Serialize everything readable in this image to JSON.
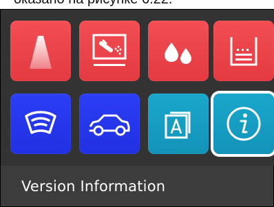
{
  "caption": {
    "text": "оказано на рисунке 6.22."
  },
  "tiles": [
    {
      "icon": "beam-light-icon",
      "color": "#e8434a"
    },
    {
      "icon": "monitor-spray-icon",
      "color": "#e8434a"
    },
    {
      "icon": "water-drops-icon",
      "color": "#e8434a"
    },
    {
      "icon": "fluid-container-icon",
      "color": "#e8434a"
    },
    {
      "icon": "windshield-icon",
      "color": "#2a3cf0"
    },
    {
      "icon": "car-outline-icon",
      "color": "#2a3cf0"
    },
    {
      "icon": "font-layers-icon",
      "color": "#18a0c8"
    },
    {
      "icon": "info-circle-icon",
      "color": "#18a0c8",
      "selected": true
    }
  ],
  "selection": {
    "label": "Version Information"
  }
}
